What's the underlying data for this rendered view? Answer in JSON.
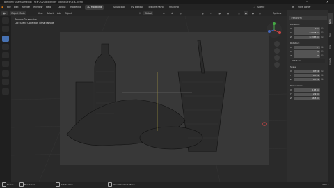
{
  "window": {
    "title": "Blender [\\Users\\Desktop\\工作室\\2020年\\Blender Tutorial\\场景\\样本.blend]",
    "minimize": "–",
    "maximize": "□",
    "close": "✕"
  },
  "menubar": {
    "items": [
      "File",
      "Edit",
      "Render",
      "Window",
      "Help"
    ],
    "tabs": [
      "Layout",
      "Modeling",
      "Sculpting",
      "UV Editing",
      "Texture Paint",
      "Shading"
    ],
    "active_tab": "3D Modeling",
    "scene_label": "Scene",
    "view_layer_label": "View Layer"
  },
  "viewport_header": {
    "mode": "Object Mode",
    "menus": [
      "View",
      "Select",
      "Add",
      "Object"
    ],
    "orientation": "Global",
    "options": "Options"
  },
  "viewport": {
    "perspective": "Camera Perspective",
    "collection": "(25) Scene Collection | 物体 Sample"
  },
  "npanel": {
    "section": "Transform",
    "location_label": "Location:",
    "location": [
      {
        "axis": "X",
        "value": "0 m"
      },
      {
        "axis": "Y",
        "value": "-0.9948 m"
      },
      {
        "axis": "Z",
        "value": "0.1363 m"
      }
    ],
    "rotation_label": "Rotation:",
    "rotation": [
      {
        "axis": "X",
        "value": "0°"
      },
      {
        "axis": "Y",
        "value": "0°"
      },
      {
        "axis": "Z",
        "value": "0°"
      }
    ],
    "rotation_mode": "XYZ Euler",
    "scale_label": "Scale:",
    "scale": [
      {
        "axis": "X",
        "value": "0.714"
      },
      {
        "axis": "Y",
        "value": "0.714"
      },
      {
        "axis": "Z",
        "value": "0.714"
      }
    ],
    "dimensions_label": "Dimensions:",
    "dimensions": [
      {
        "axis": "X",
        "value": "9.15 m"
      },
      {
        "axis": "Y",
        "value": "2.2 m"
      },
      {
        "axis": "Z",
        "value": "16.5 m"
      }
    ],
    "tabs": [
      "Item",
      "Tool",
      "View",
      "Create"
    ]
  },
  "statusbar": {
    "select": "Select",
    "box_select": "Box Select",
    "rotate_view": "Rotate View",
    "context_menu": "Object Context Menu",
    "version": "2.93.4"
  }
}
